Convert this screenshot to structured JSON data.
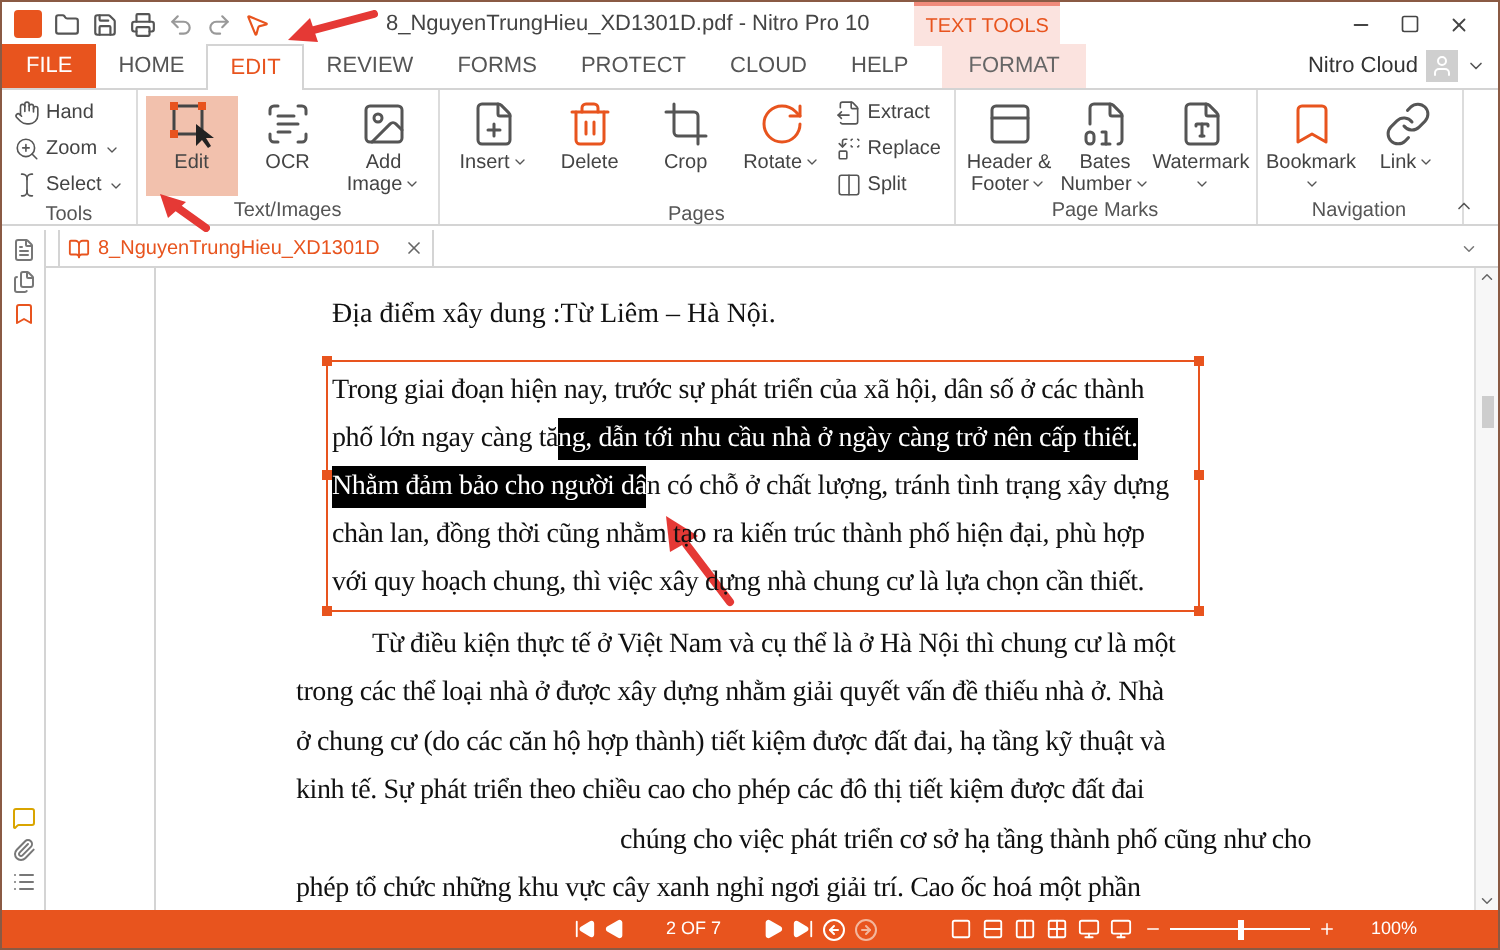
{
  "window": {
    "title": "8_NguyenTrungHieu_XD1301D.pdf - Nitro Pro 10",
    "context_tab": "TEXT TOOLS"
  },
  "menu_tabs": [
    {
      "label": "FILE",
      "kind": "file",
      "selected": false
    },
    {
      "label": "HOME",
      "kind": "plain",
      "selected": false
    },
    {
      "label": "EDIT",
      "kind": "plain",
      "selected": true
    },
    {
      "label": "REVIEW",
      "kind": "plain",
      "selected": false
    },
    {
      "label": "FORMS",
      "kind": "plain",
      "selected": false
    },
    {
      "label": "PROTECT",
      "kind": "plain",
      "selected": false
    },
    {
      "label": "CLOUD",
      "kind": "plain",
      "selected": false
    },
    {
      "label": "HELP",
      "kind": "plain",
      "selected": false
    },
    {
      "label": "FORMAT",
      "kind": "context",
      "selected": false
    }
  ],
  "account": {
    "label": "Nitro Cloud"
  },
  "ribbon_groups": [
    {
      "label": "Tools",
      "small_buttons": [
        {
          "label": "Hand",
          "kind": "hand",
          "dropdown": false,
          "selected": false
        },
        {
          "label": "Zoom",
          "kind": "zoom",
          "dropdown": true,
          "selected": false
        },
        {
          "label": "Select",
          "kind": "select",
          "dropdown": true,
          "selected": false
        }
      ]
    },
    {
      "label": "Text/Images",
      "buttons": [
        {
          "label": "Edit",
          "kind": "edit",
          "dropdown": false,
          "selected": true
        },
        {
          "label": "OCR",
          "kind": "ocr",
          "dropdown": false,
          "selected": false
        },
        {
          "label": "Add Image",
          "kind": "image",
          "dropdown": true,
          "selected": false
        }
      ]
    },
    {
      "label": "Pages",
      "buttons": [
        {
          "label": "Insert",
          "kind": "insert",
          "dropdown": true,
          "selected": false
        },
        {
          "label": "Delete",
          "kind": "delete",
          "dropdown": false,
          "selected": false
        },
        {
          "label": "Crop",
          "kind": "crop",
          "dropdown": false,
          "selected": false
        },
        {
          "label": "Rotate",
          "kind": "rotate",
          "dropdown": true,
          "selected": false
        }
      ],
      "small_buttons": [
        {
          "label": "Extract",
          "kind": "extract",
          "dropdown": false,
          "selected": false
        },
        {
          "label": "Replace",
          "kind": "replace",
          "dropdown": false,
          "selected": false
        },
        {
          "label": "Split",
          "kind": "split",
          "dropdown": false,
          "selected": false
        }
      ]
    },
    {
      "label": "Page Marks",
      "buttons": [
        {
          "label": "Header & Footer",
          "kind": "header",
          "dropdown": true,
          "selected": false
        },
        {
          "label": "Bates Number",
          "kind": "bates",
          "dropdown": true,
          "selected": false
        },
        {
          "label": "Watermark",
          "kind": "watermark",
          "dropdown": true,
          "selected": false
        }
      ]
    },
    {
      "label": "Navigation",
      "buttons": [
        {
          "label": "Bookmark",
          "kind": "bookmark",
          "dropdown": true,
          "selected": false
        },
        {
          "label": "Link",
          "kind": "link",
          "dropdown": true,
          "selected": false
        }
      ]
    }
  ],
  "document_tab": {
    "label": "8_NguyenTrungHieu_XD1301D"
  },
  "document": {
    "heading": "Địa điểm xây dung :Từ Liêm – Hà Nội.",
    "selected_paragraph": [
      [
        {
          "text": "Trong giai đoạn hiện nay,  trước sự phát triển của xã hội, dân số ở các thành",
          "selected": false
        }
      ],
      [
        {
          "text": "phố lớn ngay càng tă",
          "selected": false
        },
        {
          "text": "ng, dẫn tới nhu cầu nhà ở ngày càng trở nên cấp thiết.",
          "selected": true
        }
      ],
      [
        {
          "text": "Nhằm đảm bảo cho người dâ",
          "selected": true
        },
        {
          "text": "n có chỗ ở chất lượng, tránh tình trạng xây dựng",
          "selected": false
        }
      ],
      [
        {
          "text": "chàn lan, đồng thời cũng nhằm tạo ra kiến trúc thành phố hiện đại, phù hợp",
          "selected": false
        }
      ],
      [
        {
          "text": "với quy hoạch chung, thì việc xây dựng nhà chung cư là lựa chọn cần thiết.",
          "selected": false
        }
      ]
    ],
    "lines": [
      {
        "text": "Từ điều kiện thực tế ở Việt Nam và cụ thể là ở Hà Nội thì chung cư là một",
        "kind": "indent"
      },
      {
        "text": "trong các thể loại nhà ở được xây dựng nhằm giải quyết vấn đề thiếu nhà ở. Nhà",
        "kind": "plain"
      },
      {
        "text": "ở chung cư (do các căn hộ hợp thành) tiết kiệm được đất đai, hạ tầng kỹ thuật và",
        "kind": "plain"
      },
      {
        "text": "kinh tế. Sự phát triển theo chiều cao cho phép các đô thị tiết kiệm được đất đai",
        "kind": "plain"
      },
      {
        "text": "chúng cho việc phát triển cơ sở hạ tầng thành phố cũng như cho",
        "kind": "gap"
      },
      {
        "text": "phép tổ chức những khu vực cây xanh nghỉ ngơi giải trí. Cao ốc hoá một phần",
        "kind": "plain"
      }
    ]
  },
  "status_bar": {
    "page": "2 OF 7",
    "zoom": {
      "level": 0.5,
      "reading": "100%"
    }
  }
}
